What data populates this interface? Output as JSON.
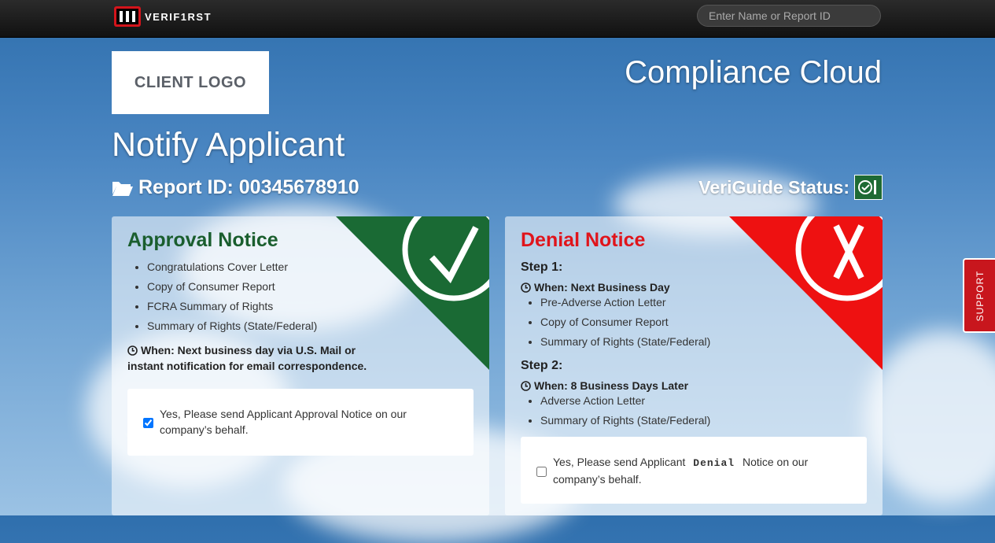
{
  "topbar": {
    "brand": "VERIF1RST",
    "search_placeholder": "Enter Name or Report ID"
  },
  "header": {
    "client_logo": "CLIENT LOGO",
    "app_title": "Compliance Cloud",
    "page_title": "Notify Applicant",
    "report_id_label": "Report ID: 00345678910",
    "vg_status_label": "VeriGuide Status:"
  },
  "approval": {
    "title": "Approval Notice",
    "items": [
      "Congratulations Cover Letter",
      "Copy of Consumer Report",
      "FCRA Summary of Rights",
      "Summary of Rights (State/Federal)"
    ],
    "when_line1": "When: Next business day via U.S. Mail or",
    "when_line2": "instant notification for email correspondence.",
    "checkbox_checked": true,
    "option_text": "Yes, Please send Applicant Approval Notice on our company’s behalf."
  },
  "denial": {
    "title": "Denial Notice",
    "step1": "Step 1:",
    "step1_when": "When: Next Business Day",
    "step1_items": [
      "Pre-Adverse Action Letter",
      "Copy of Consumer Report",
      "Summary of Rights (State/Federal)"
    ],
    "step2": "Step 2:",
    "step2_when": "When: 8 Business Days Later",
    "step2_items": [
      "Adverse Action Letter",
      "Summary of Rights (State/Federal)"
    ],
    "checkbox_checked": false,
    "option_pre": "Yes, Please send Applicant",
    "option_word": "Denial",
    "option_post": "Notice on our company’s behalf."
  },
  "support_tab": "SUPPORT",
  "colors": {
    "approval_green": "#1a6a34",
    "denial_red": "#ee1111",
    "topbar": "#1a1a1a"
  }
}
